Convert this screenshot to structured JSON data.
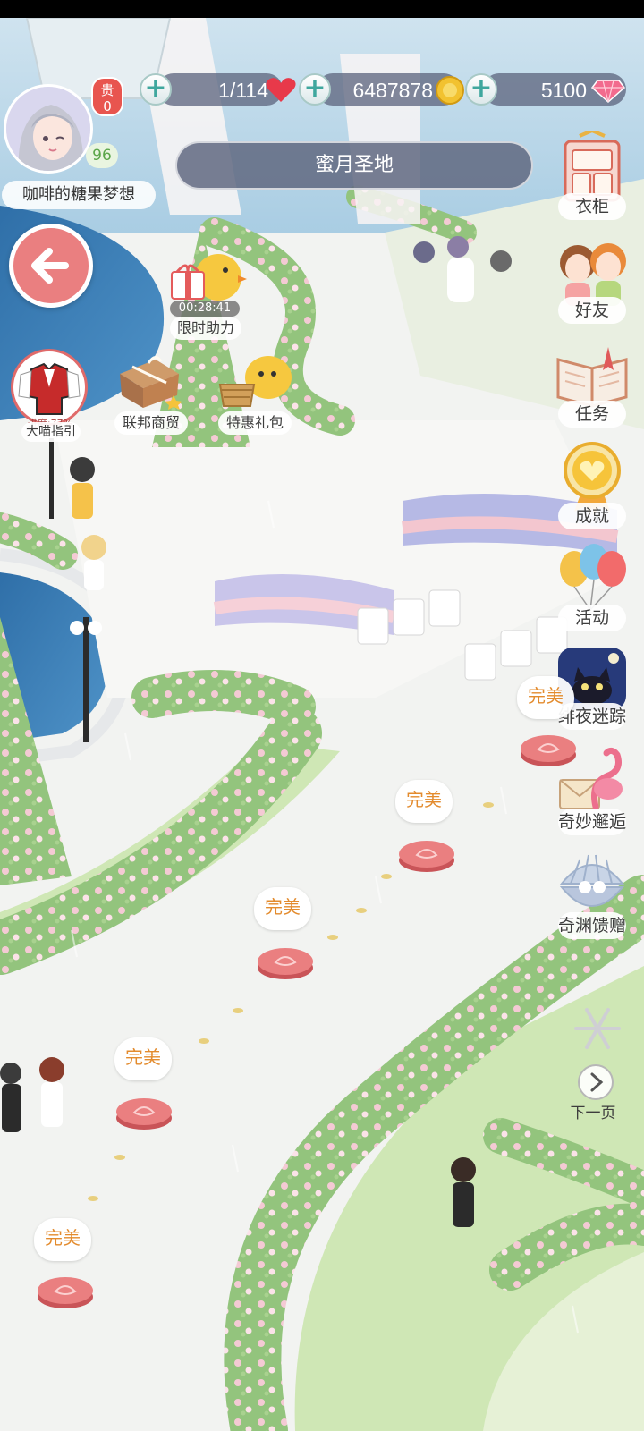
{
  "player": {
    "name": "咖啡的糖果梦想",
    "level": "96",
    "vip_prefix": "贵",
    "vip_level": "0"
  },
  "resources": {
    "stamina": "1/114",
    "gold": "6487878",
    "diamonds": "5100"
  },
  "location": {
    "title": "蜜月圣地"
  },
  "left_features": {
    "limited_help": {
      "label": "限时助力",
      "timer": "00:28:41"
    },
    "guide": {
      "label": "大喵指引",
      "progress": "进度:77%"
    },
    "federation_trade": {
      "label": "联邦商贸"
    },
    "special_pack": {
      "label": "特惠礼包"
    }
  },
  "right_menu": [
    {
      "label": "衣柜",
      "icon": "wardrobe-icon"
    },
    {
      "label": "好友",
      "icon": "friends-icon"
    },
    {
      "label": "任务",
      "icon": "quest-book-icon"
    },
    {
      "label": "成就",
      "icon": "achievement-medal-icon"
    },
    {
      "label": "活动",
      "icon": "balloons-icon"
    },
    {
      "label": "绯夜迷踪",
      "icon": "night-cat-icon"
    },
    {
      "label": "奇妙邂逅",
      "icon": "flamingo-letter-icon"
    },
    {
      "label": "奇渊馈赠",
      "icon": "shell-pearl-icon"
    }
  ],
  "next_page": {
    "label": "下一页"
  },
  "stages": [
    {
      "rating": "完美"
    },
    {
      "rating": "完美"
    },
    {
      "rating": "完美"
    },
    {
      "rating": "完美"
    },
    {
      "rating": "完美"
    }
  ],
  "colors": {
    "accent_pink": "#ea7f80",
    "perfect_text": "#e38b2d",
    "resource_bar": "#606880",
    "hedge_green": "#8fc27a",
    "blossom_pink": "#f2c6cf"
  }
}
